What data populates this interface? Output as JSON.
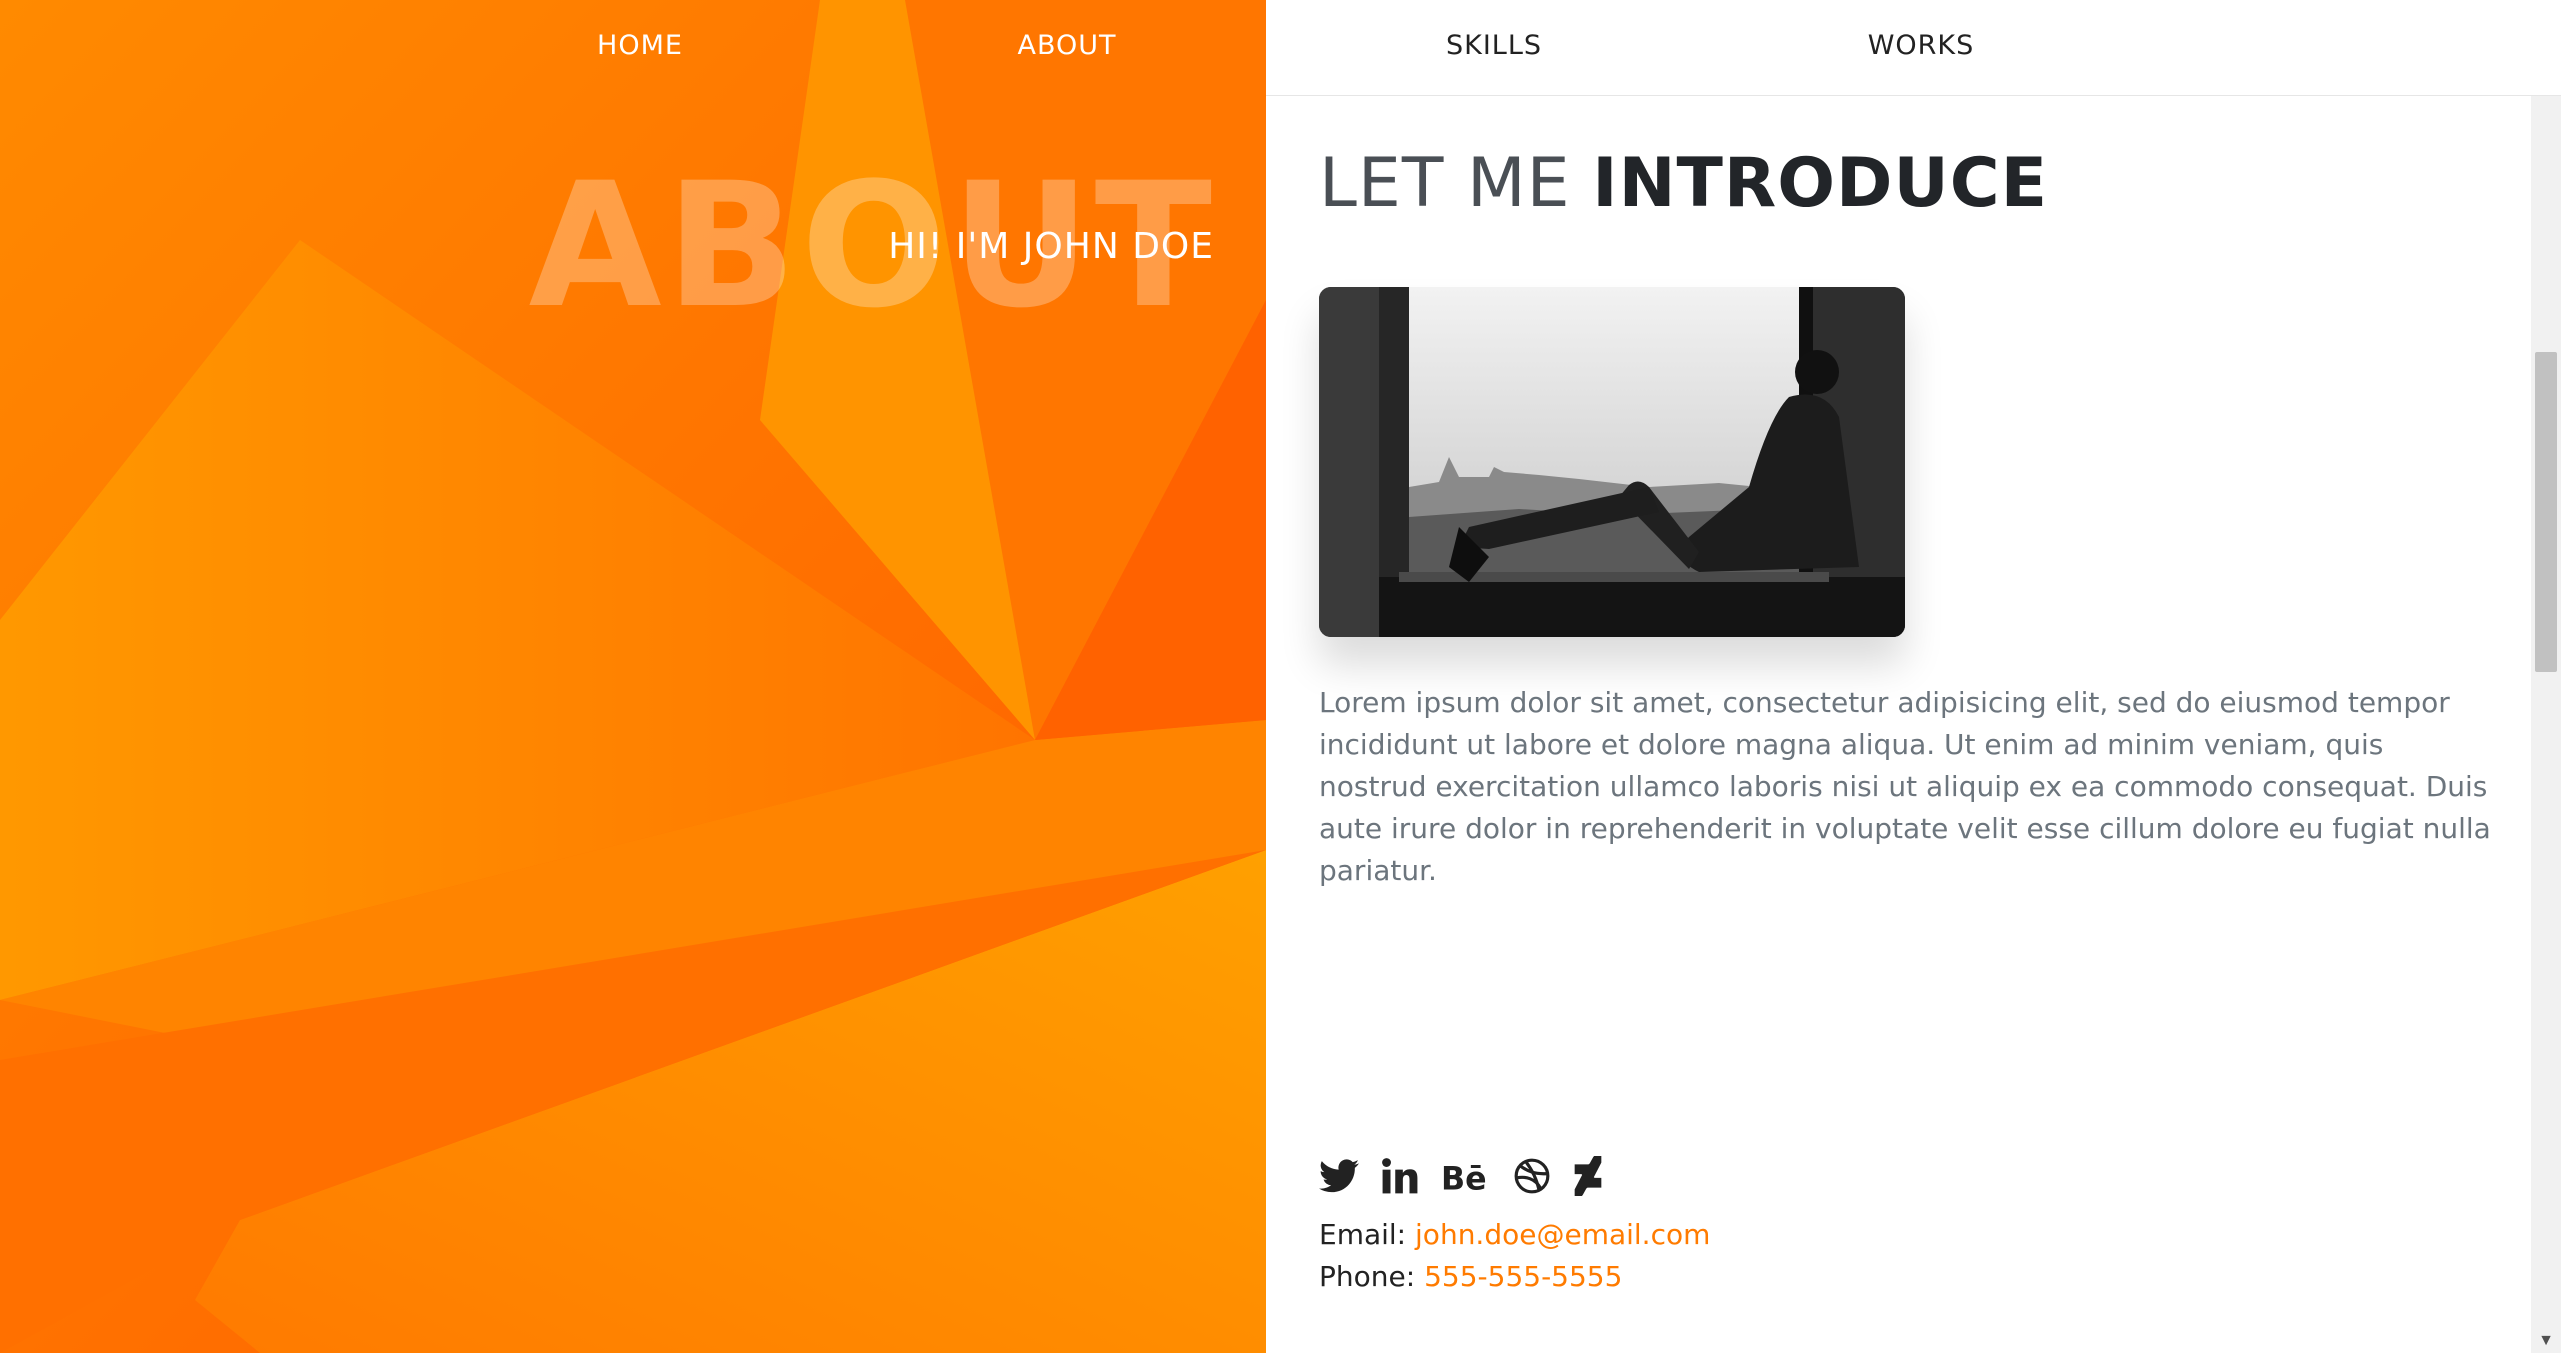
{
  "nav": {
    "items": [
      {
        "label": "HOME"
      },
      {
        "label": "ABOUT"
      },
      {
        "label": "SKILLS"
      },
      {
        "label": "WORKS"
      }
    ]
  },
  "hero": {
    "title": "ABOUT",
    "subtitle": "HI! I'M JOHN DOE"
  },
  "about": {
    "heading_light": "LET ME",
    "heading_bold": "INTRODUCE",
    "bio": "Lorem ipsum dolor sit amet, consectetur adipisicing elit, sed do eiusmod tempor incididunt ut labore et dolore magna aliqua. Ut enim ad minim veniam, quis nostrud exercitation ullamco laboris nisi ut aliquip ex ea commodo consequat. Duis aute irure dolor in reprehenderit in voluptate velit esse cillum dolore eu fugiat nulla pariatur."
  },
  "social": {
    "icons": [
      "twitter-icon",
      "linkedin-icon",
      "behance-icon",
      "dribbble-icon",
      "deviantart-icon"
    ]
  },
  "contact": {
    "email_label": "Email:",
    "email": "john.doe@email.com",
    "phone_label": "Phone:",
    "phone": "555-555-5555"
  },
  "colors": {
    "accent": "#ff7b00",
    "hero_orange": "#ff6a00",
    "heading": "#222529",
    "body_text": "#6c757d"
  }
}
